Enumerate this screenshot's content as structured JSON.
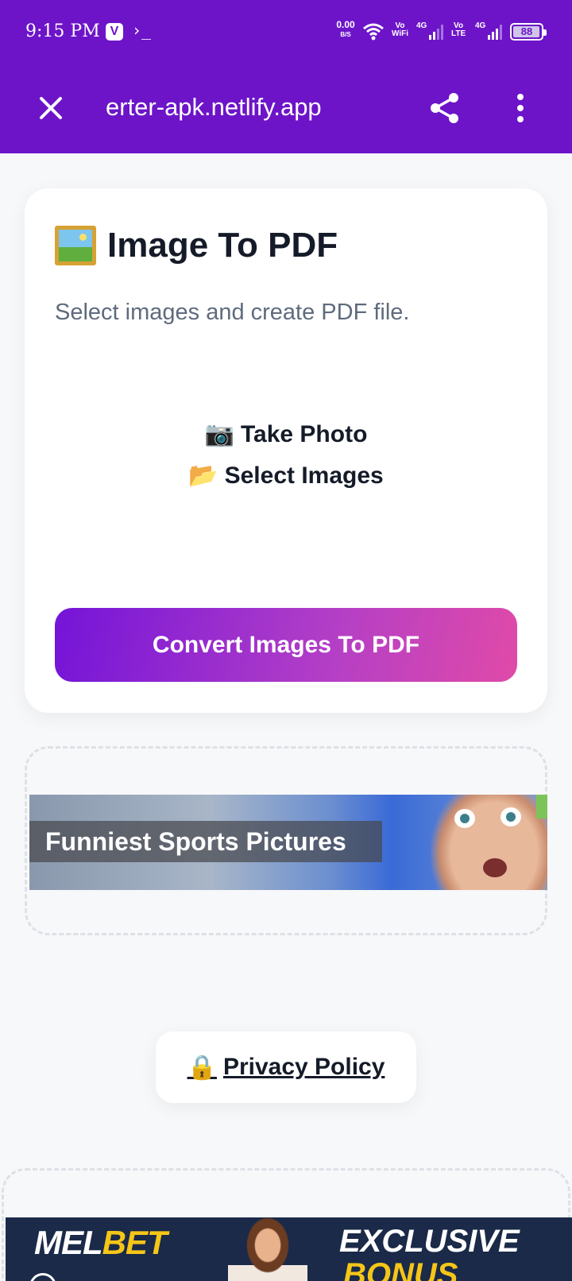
{
  "status_bar": {
    "time": "9:15 PM",
    "app_badge": "V",
    "terminal_glyph": "›_",
    "net_speed_value": "0.00",
    "net_speed_unit": "B/S",
    "vowifi_label_top": "Vo",
    "vowifi_label_bottom": "WiFi",
    "sim1_type": "4G",
    "volte_label_top": "Vo",
    "volte_label_bottom": "LTE",
    "sim2_type": "4G",
    "battery_level": "88"
  },
  "app_bar": {
    "url": "erter-apk.netlify.app",
    "bg_color": "#6d14c9"
  },
  "card": {
    "title": "Image To PDF",
    "subtitle": "Select images and create PDF file.",
    "take_photo_emoji": "📷",
    "take_photo_label": "Take Photo",
    "select_images_emoji": "📂",
    "select_images_label": "Select Images",
    "convert_button": "Convert Images To PDF"
  },
  "ad1": {
    "caption": "Funniest Sports Pictures"
  },
  "privacy": {
    "emoji": "🔒",
    "label": "Privacy Policy"
  },
  "ad2": {
    "logo_part1": "MEL",
    "logo_part2": "BET",
    "promo_line1": "EXCLUSIVE",
    "promo_line2": "BONUS"
  }
}
